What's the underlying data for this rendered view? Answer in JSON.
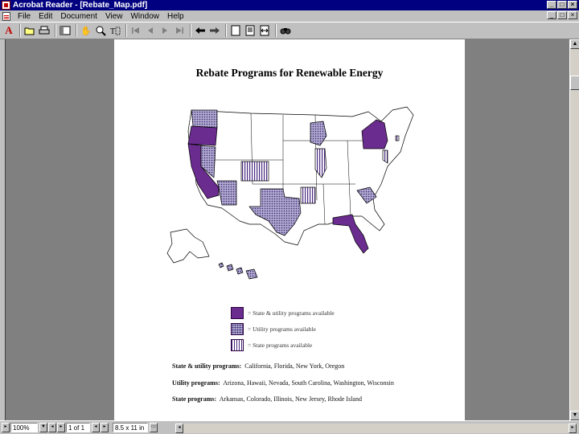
{
  "window": {
    "title": "Acrobat Reader - [Rebate_Map.pdf]"
  },
  "window_buttons": {
    "minimize": "_",
    "maximize": "□",
    "close": "×"
  },
  "menu": [
    "File",
    "Edit",
    "Document",
    "View",
    "Window",
    "Help"
  ],
  "toolbar_icons": [
    "acrobat-logo-icon",
    "open-icon",
    "print-icon",
    "show-hide-navigation-icon",
    "hand-tool-icon",
    "zoom-tool-icon",
    "text-select-icon",
    "first-page-icon",
    "previous-page-icon",
    "next-page-icon",
    "last-page-icon",
    "go-back-icon",
    "go-forward-icon",
    "actual-size-icon",
    "fit-page-icon",
    "fit-width-icon",
    "find-icon"
  ],
  "document": {
    "title": "Rebate Programs for Renewable Energy",
    "legend": [
      {
        "pattern": "solid",
        "text": "= State & utility programs available"
      },
      {
        "pattern": "utility",
        "text": "= Utility programs available"
      },
      {
        "pattern": "state",
        "text": "= State programs available"
      }
    ],
    "colors": {
      "state_and_utility": "#6a2c8e",
      "utility_pattern": "#b0a8d0",
      "state_pattern": "#4a2a80"
    },
    "programs": {
      "state_utility": {
        "label": "State & utility programs:",
        "value": "California, Florida, New York, Oregon"
      },
      "utility": {
        "label": "Utility programs:",
        "value": "Arizona, Hawaii, Nevada, South Carolina, Washington, Wisconsin"
      },
      "state": {
        "label": "State programs:",
        "value": "Arkansas, Colorado, Illinois, New Jersey, Rhode Island"
      }
    }
  },
  "status": {
    "zoom": "100%",
    "page": "1 of 1",
    "page_size": "8.5 x 11 in"
  }
}
